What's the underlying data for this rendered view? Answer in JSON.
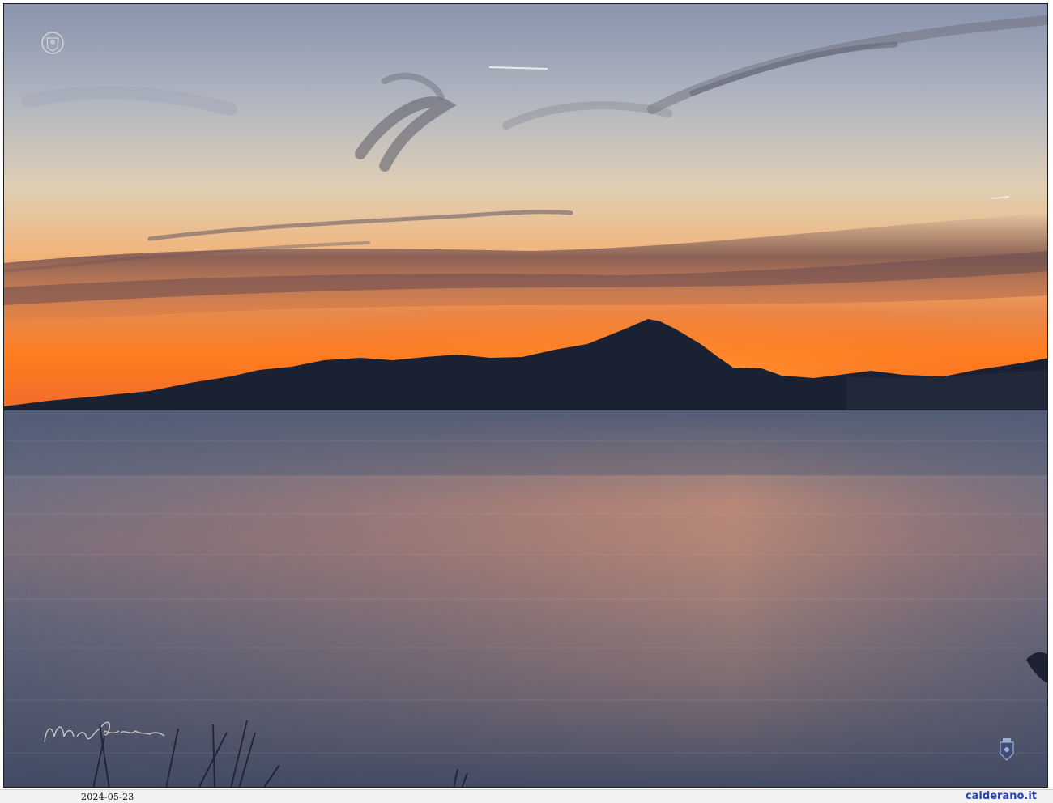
{
  "photo": {
    "date": "2024-05-23",
    "site": "calderano.it",
    "signature": "Mary Calderano"
  },
  "colors": {
    "sky_top": "#8c98b2",
    "sky_mid": "#cfcfc6",
    "sky_warm": "#f2b06a",
    "horizon_glow": "#ff7a1a",
    "cloud_band": "#7a5150",
    "mountain": "#1b2233",
    "sea_top": "#4f5a72",
    "sea_reflection": "#c07a68",
    "sea_bottom": "#47506a",
    "site_link": "#2b3fb5"
  },
  "icons": [
    "watermark-seal-icon",
    "crest-icon"
  ]
}
